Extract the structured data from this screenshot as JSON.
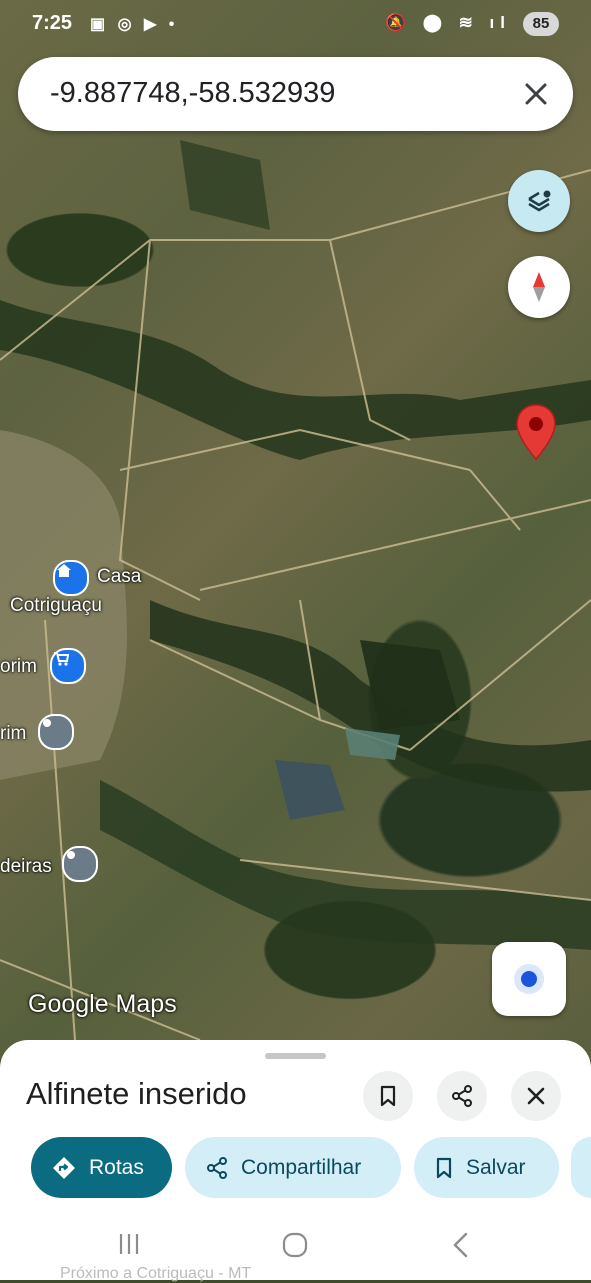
{
  "status_bar": {
    "time": "7:25",
    "left_icons": "▣ ◎ ▶ •",
    "right_icons": "🔕 ⬤ ≋ ıl",
    "battery": "85"
  },
  "search": {
    "query": "-9.887748,-58.532939"
  },
  "map": {
    "places": [
      {
        "line1": "Casa",
        "line2": "Cotriguaçu",
        "icon": "home-icon"
      },
      {
        "label": "orim",
        "icon": "shopping-cart-icon"
      },
      {
        "label": "rim",
        "icon": "place-pin-icon"
      },
      {
        "label": "deiras",
        "icon": "place-pin-icon"
      }
    ],
    "attribution": "Google Maps"
  },
  "sheet": {
    "title": "Alfinete inserido",
    "chips": {
      "routes": "Rotas",
      "share": "Compartilhar",
      "save": "Salvar"
    },
    "peek_text": "Próximo a Cotriguaçu - MT"
  },
  "colors": {
    "pin_red": "#e53935",
    "chip_primary": "#0b6b80",
    "chip_secondary": "#d3eef7",
    "poi_blue": "#1a73e8",
    "poi_gray": "#6b7b88"
  }
}
